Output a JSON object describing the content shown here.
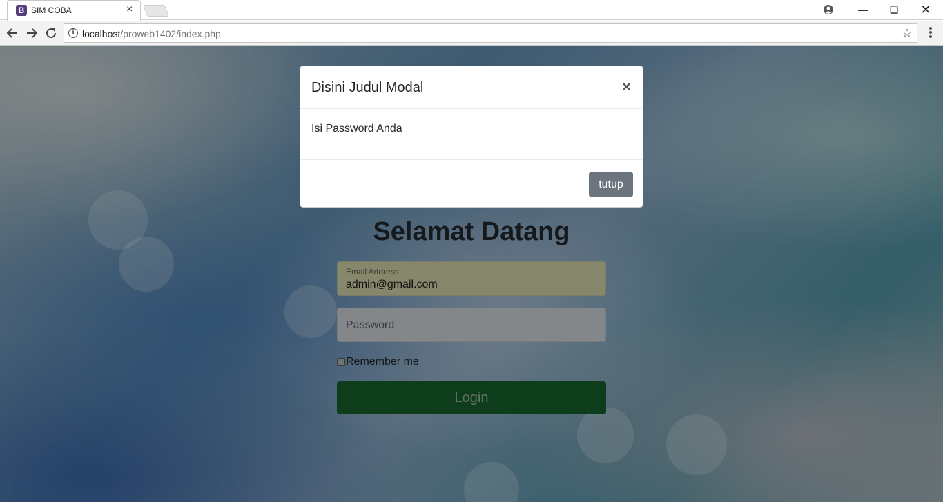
{
  "browser": {
    "tab_title": "SIM COBA",
    "tab_favicon_letter": "B",
    "url_host": "localhost",
    "url_path": "/proweb1402/index.php",
    "icons": [
      "back-arrow-icon",
      "forward-arrow-icon",
      "reload-icon",
      "info-icon",
      "star-icon",
      "menu-icon",
      "profile-icon",
      "minimize-icon",
      "restore-icon",
      "close-icon"
    ]
  },
  "modal": {
    "title": "Disini Judul Modal",
    "close_glyph": "×",
    "body": "Isi Password Anda",
    "footer_button": "tutup"
  },
  "login": {
    "title": "Selamat Datang",
    "email_label": "Email Address",
    "email_value": "admin@gmail.com",
    "password_placeholder": "Password",
    "remember_label": "Remember me",
    "submit_label": "Login"
  },
  "colors": {
    "brand_favicon": "#563d7c",
    "login_button": "#1e7e34",
    "secondary_button": "#6c757d"
  }
}
